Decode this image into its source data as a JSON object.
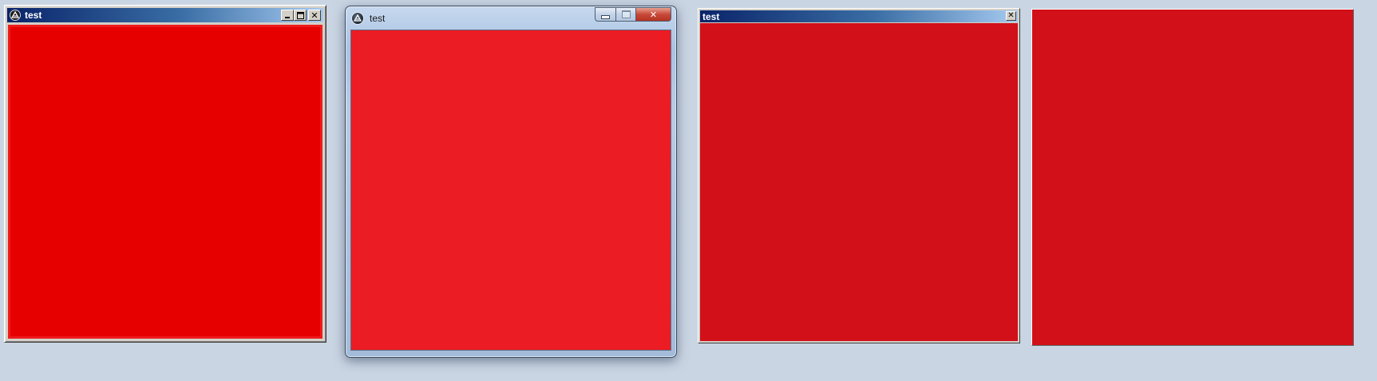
{
  "windows": [
    {
      "style": "classic",
      "title": "test",
      "buttons": {
        "minimize_icon": "minimize-icon",
        "maximize_icon": "maximize-icon",
        "close_icon": "close-icon",
        "close_glyph": "✕"
      },
      "client_color": "#e60000"
    },
    {
      "style": "aero",
      "title": "test",
      "buttons": {
        "minimize_icon": "minimize-icon",
        "maximize_icon": "maximize-icon",
        "close_icon": "close-icon",
        "close_glyph": "✕"
      },
      "client_color": "#ec1c24"
    },
    {
      "style": "toolwindow",
      "title": "test",
      "buttons": {
        "close_icon": "close-icon",
        "close_glyph": "✕"
      },
      "client_color": "#d11019"
    },
    {
      "style": "borderless",
      "client_color": "#d11019"
    }
  ],
  "desktop": {
    "background": "#cad5e3"
  }
}
